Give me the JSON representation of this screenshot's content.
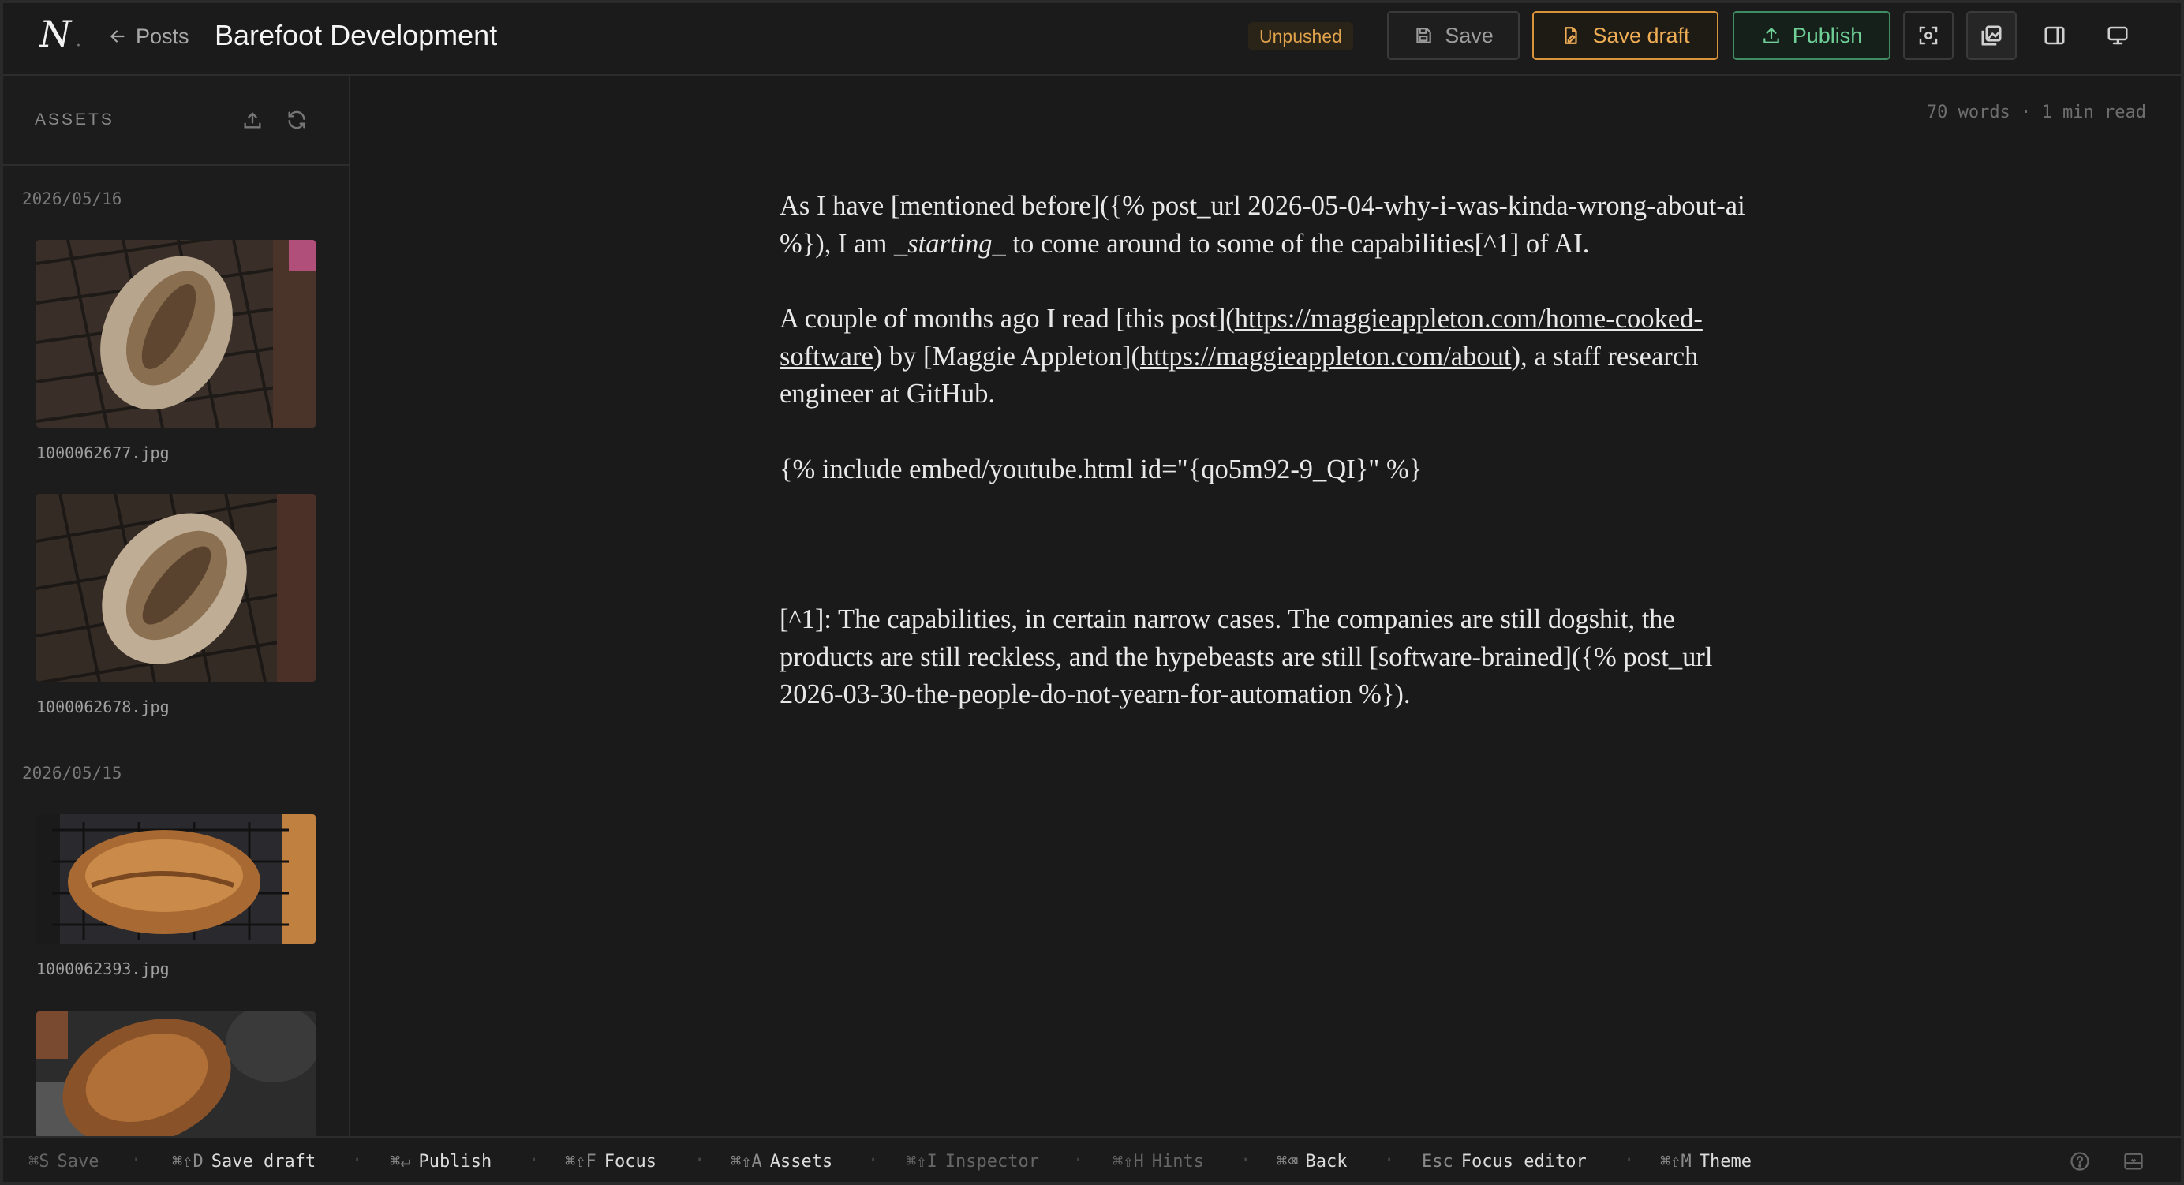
{
  "app": {
    "logo_text": "N",
    "logo_dot": "·",
    "back_label": "Posts",
    "title": "Barefoot Development"
  },
  "toolbar": {
    "status_badge": "Unpushed",
    "save_label": "Save",
    "save_draft_label": "Save draft",
    "publish_label": "Publish",
    "icons": [
      "save-icon",
      "file-draft-icon",
      "upload-icon",
      "focus-icon",
      "assets-icon",
      "sidebar-panel-icon",
      "monitor-icon"
    ],
    "colors": {
      "draft": "#d9943a",
      "publish": "#3f8d62",
      "unpushed": "#e0a24a"
    }
  },
  "sidebar": {
    "title": "ASSETS",
    "groups": [
      {
        "date": "2026/05/16",
        "files": [
          "1000062677.jpg",
          "1000062678.jpg"
        ]
      },
      {
        "date": "2026/05/15",
        "files": [
          "1000062393.jpg",
          ""
        ]
      }
    ]
  },
  "editor": {
    "meta": "70 words · 1 min read",
    "p1a": "As I have [mentioned before]({% post_url 2026-05-04-why-i-was-kinda-wrong-about-ai %}), I am ",
    "p1em_pre": "_",
    "p1em": "starting",
    "p1em_post": "_",
    "p1b": " to come around to some of the capabilities[^1] of AI.",
    "p2a": "A couple of months ago I read [this post](",
    "p2link1": "https://maggieappleton.com/home-cooked-software",
    "p2b": ") by [Maggie Appleton](",
    "p2link2": "https://maggieappleton.com/about",
    "p2c": "), a staff research engineer at GitHub.",
    "p3": "{% include embed/youtube.html id=\"{qo5m92-9_QI}\" %}",
    "p4": "[^1]: The capabilities, in certain narrow cases. The companies are still dogshit, the products are still reckless, and the hypebeasts are still [software-brained]({% post_url 2026-03-30-the-people-do-not-yearn-for-automation %})."
  },
  "statusbar": {
    "hints": [
      {
        "key": "⌘S",
        "label": "Save",
        "dim": true
      },
      {
        "key": "⌘⇧D",
        "label": "Save draft",
        "dim": false
      },
      {
        "key": "⌘↵",
        "label": "Publish",
        "dim": false
      },
      {
        "key": "⌘⇧F",
        "label": "Focus",
        "dim": false
      },
      {
        "key": "⌘⇧A",
        "label": "Assets",
        "dim": false
      },
      {
        "key": "⌘⇧I",
        "label": "Inspector",
        "dim": true
      },
      {
        "key": "⌘⇧H",
        "label": "Hints",
        "dim": true
      },
      {
        "key": "⌘⌫",
        "label": "Back",
        "dim": false
      },
      {
        "key": "Esc",
        "label": "Focus editor",
        "dim": false
      },
      {
        "key": "⌘⇧M",
        "label": "Theme",
        "dim": false
      }
    ]
  }
}
